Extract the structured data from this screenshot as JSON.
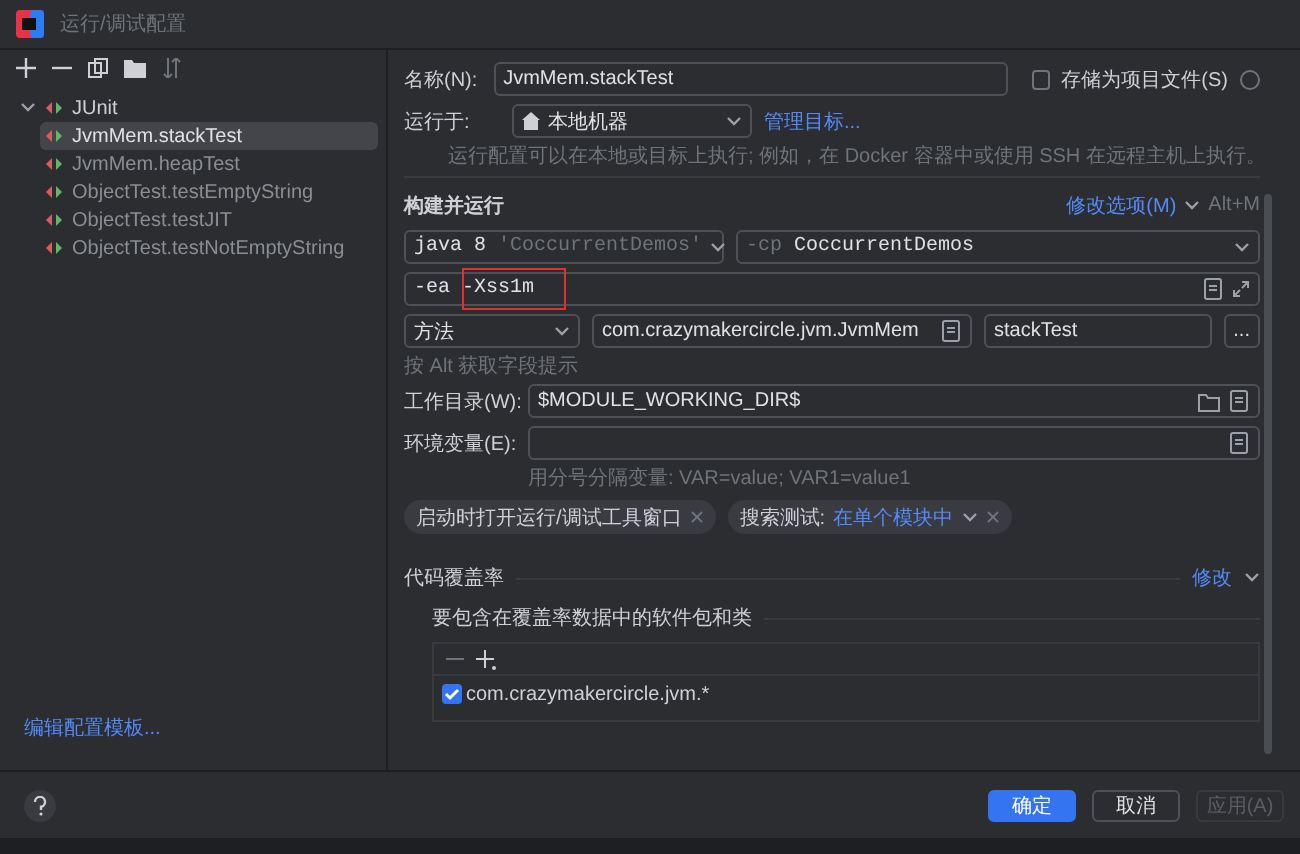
{
  "window": {
    "title": "运行/调试配置"
  },
  "tree": {
    "label": "JUnit",
    "expanded": true,
    "children": [
      {
        "label": "JvmMem.stackTest",
        "selected": true
      },
      {
        "label": "JvmMem.heapTest",
        "selected": false
      },
      {
        "label": "ObjectTest.testEmptyString",
        "selected": false
      },
      {
        "label": "ObjectTest.testJIT",
        "selected": false
      },
      {
        "label": "ObjectTest.testNotEmptyString",
        "selected": false
      }
    ]
  },
  "edit_templates_link": "编辑配置模板...",
  "name_field": {
    "label": "名称(N):",
    "value": "JvmMem.stackTest"
  },
  "store_checkbox": {
    "label": "存储为项目文件(S)",
    "checked": false
  },
  "run_on": {
    "label": "运行于:",
    "value": "本地机器",
    "link": "管理目标...",
    "hint": "运行配置可以在本地或目标上执行; 例如，在 Docker 容器中或使用 SSH 在远程主机上执行。"
  },
  "build": {
    "title": "构建并运行",
    "modify_options": "修改选项(M)",
    "shortcut": "Alt+M",
    "jdk": {
      "name": "java 8",
      "module": "'CoccurrentDemos'"
    },
    "classpath": {
      "flag": "-cp",
      "module": "CoccurrentDemos"
    },
    "vm_options": {
      "value": "-ea -Xss1m",
      "highlighted": true
    },
    "test_kind": "方法",
    "class": "com.crazymakercircle.jvm.JvmMem",
    "method": "stackTest",
    "more": "...",
    "hint": "按 Alt 获取字段提示"
  },
  "working_dir": {
    "label": "工作目录(W):",
    "value": "$MODULE_WORKING_DIR$"
  },
  "env": {
    "label": "环境变量(E):",
    "hint": "用分号分隔变量: VAR=value; VAR1=value1"
  },
  "chips": [
    {
      "label": "启动时打开运行/调试工具窗口"
    },
    {
      "label": "搜索测试:",
      "value": "在单个模块中"
    }
  ],
  "coverage": {
    "title": "代码覆盖率",
    "modify": "修改",
    "subtitle": "要包含在覆盖率数据中的软件包和类",
    "items": [
      {
        "label": "com.crazymakercircle.jvm.*",
        "checked": true
      }
    ]
  },
  "buttons": [
    {
      "label": "确定",
      "kind": "primary"
    },
    {
      "label": "取消",
      "kind": "normal"
    },
    {
      "label": "应用(A)",
      "kind": "disabled"
    }
  ]
}
